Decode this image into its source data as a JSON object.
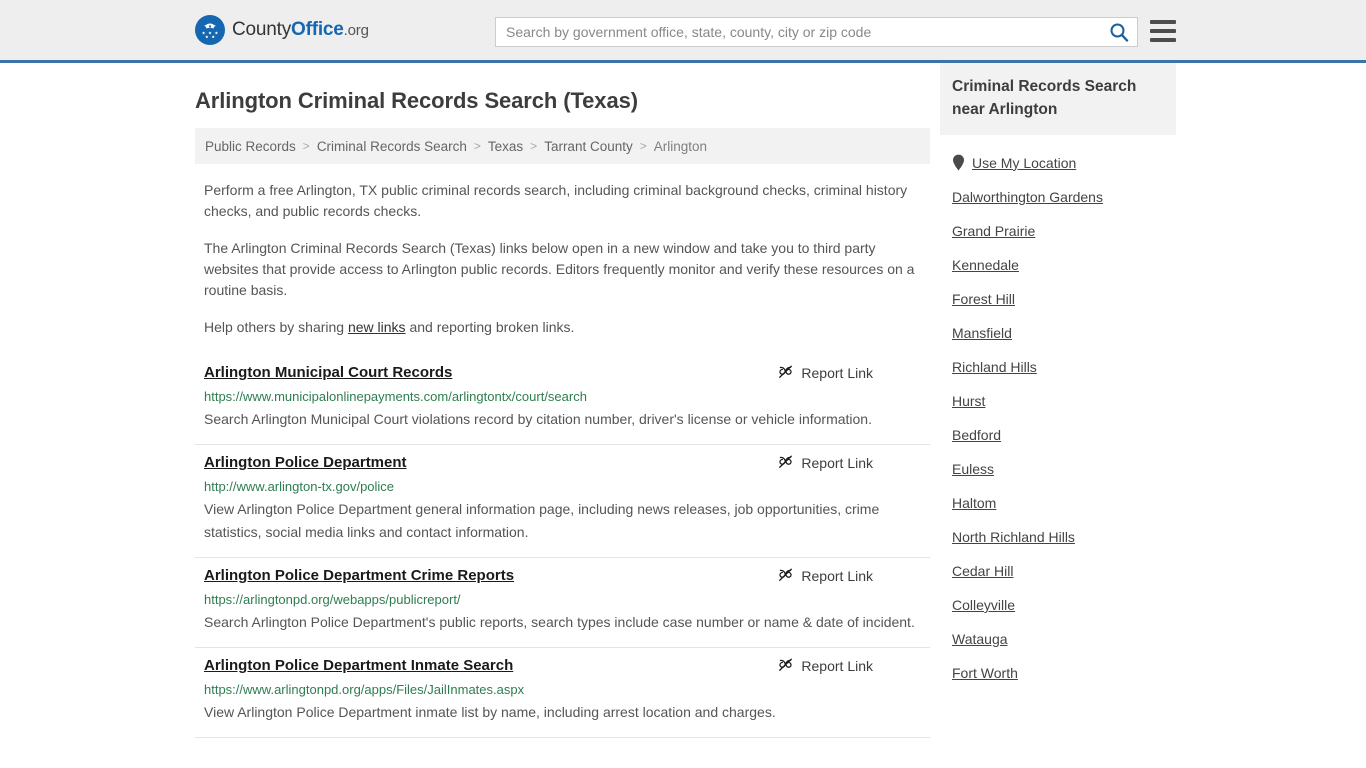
{
  "header": {
    "logo": {
      "icon": "eagle-seal-icon",
      "text_county": "County",
      "text_office": "Office",
      "text_org": ".org"
    },
    "search": {
      "placeholder": "Search by government office, state, county, city or zip code",
      "value": "",
      "icon": "search-icon"
    },
    "menu_icon": "hamburger-menu-icon"
  },
  "main": {
    "title": "Arlington Criminal Records Search (Texas)",
    "breadcrumb": [
      "Public Records",
      "Criminal Records Search",
      "Texas",
      "Tarrant County",
      "Arlington"
    ],
    "breadcrumb_separator": ">",
    "paragraphs": {
      "p1": "Perform a free Arlington, TX public criminal records search, including criminal background checks, criminal history checks, and public records checks.",
      "p2": "The Arlington Criminal Records Search (Texas) links below open in a new window and take you to third party websites that provide access to Arlington public records. Editors frequently monitor and verify these resources on a routine basis.",
      "p3_before": "Help others by sharing ",
      "p3_link": "new links",
      "p3_after": " and reporting broken links."
    },
    "report_link_label": "Report Link",
    "report_link_icon": "broken-link-icon",
    "results": [
      {
        "title": "Arlington Municipal Court Records",
        "url": "https://www.municipalonlinepayments.com/arlingtontx/court/search",
        "description": "Search Arlington Municipal Court violations record by citation number, driver's license or vehicle information."
      },
      {
        "title": "Arlington Police Department",
        "url": "http://www.arlington-tx.gov/police",
        "description": "View Arlington Police Department general information page, including news releases, job opportunities, crime statistics, social media links and contact information."
      },
      {
        "title": "Arlington Police Department Crime Reports",
        "url": "https://arlingtonpd.org/webapps/publicreport/",
        "description": "Search Arlington Police Department's public reports, search types include case number or name & date of incident."
      },
      {
        "title": "Arlington Police Department Inmate Search",
        "url": "https://www.arlingtonpd.org/apps/Files/JailInmates.aspx",
        "description": "View Arlington Police Department inmate list by name, including arrest location and charges."
      }
    ]
  },
  "sidebar": {
    "heading": "Criminal Records Search near Arlington",
    "use_my_location": {
      "label": "Use My Location",
      "icon": "map-pin-icon"
    },
    "nearby": [
      "Dalworthington Gardens",
      "Grand Prairie",
      "Kennedale",
      "Forest Hill",
      "Mansfield",
      "Richland Hills",
      "Hurst",
      "Bedford",
      "Euless",
      "Haltom",
      "North Richland Hills",
      "Cedar Hill",
      "Colleyville",
      "Watauga",
      "Fort Worth"
    ]
  },
  "colors": {
    "header_bg": "#eeeeee",
    "header_border": "#3a74a8",
    "brand_blue": "#1667b2",
    "url_green": "#2e7d4f",
    "panel_gray": "#f2f2f2"
  }
}
